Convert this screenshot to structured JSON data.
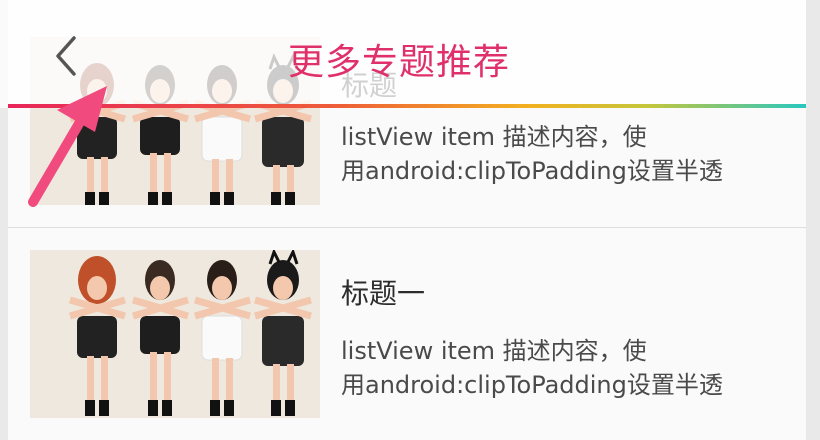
{
  "header": {
    "title": "更多专题推荐",
    "back_icon": "chevron-left-icon",
    "title_color": "#e0306b"
  },
  "accent_gradient": [
    "#e8265a",
    "#f2b020",
    "#28c7c0"
  ],
  "annotation_arrow_color": "#f04a7e",
  "list": {
    "items": [
      {
        "title": "标题",
        "description_line1": "listView item 描述内容，使",
        "description_line2": "用android:clipToPadding设置半透"
      },
      {
        "title": "标题一",
        "description_line1": "listView item 描述内容，使",
        "description_line2": "用android:clipToPadding设置半透"
      }
    ]
  }
}
